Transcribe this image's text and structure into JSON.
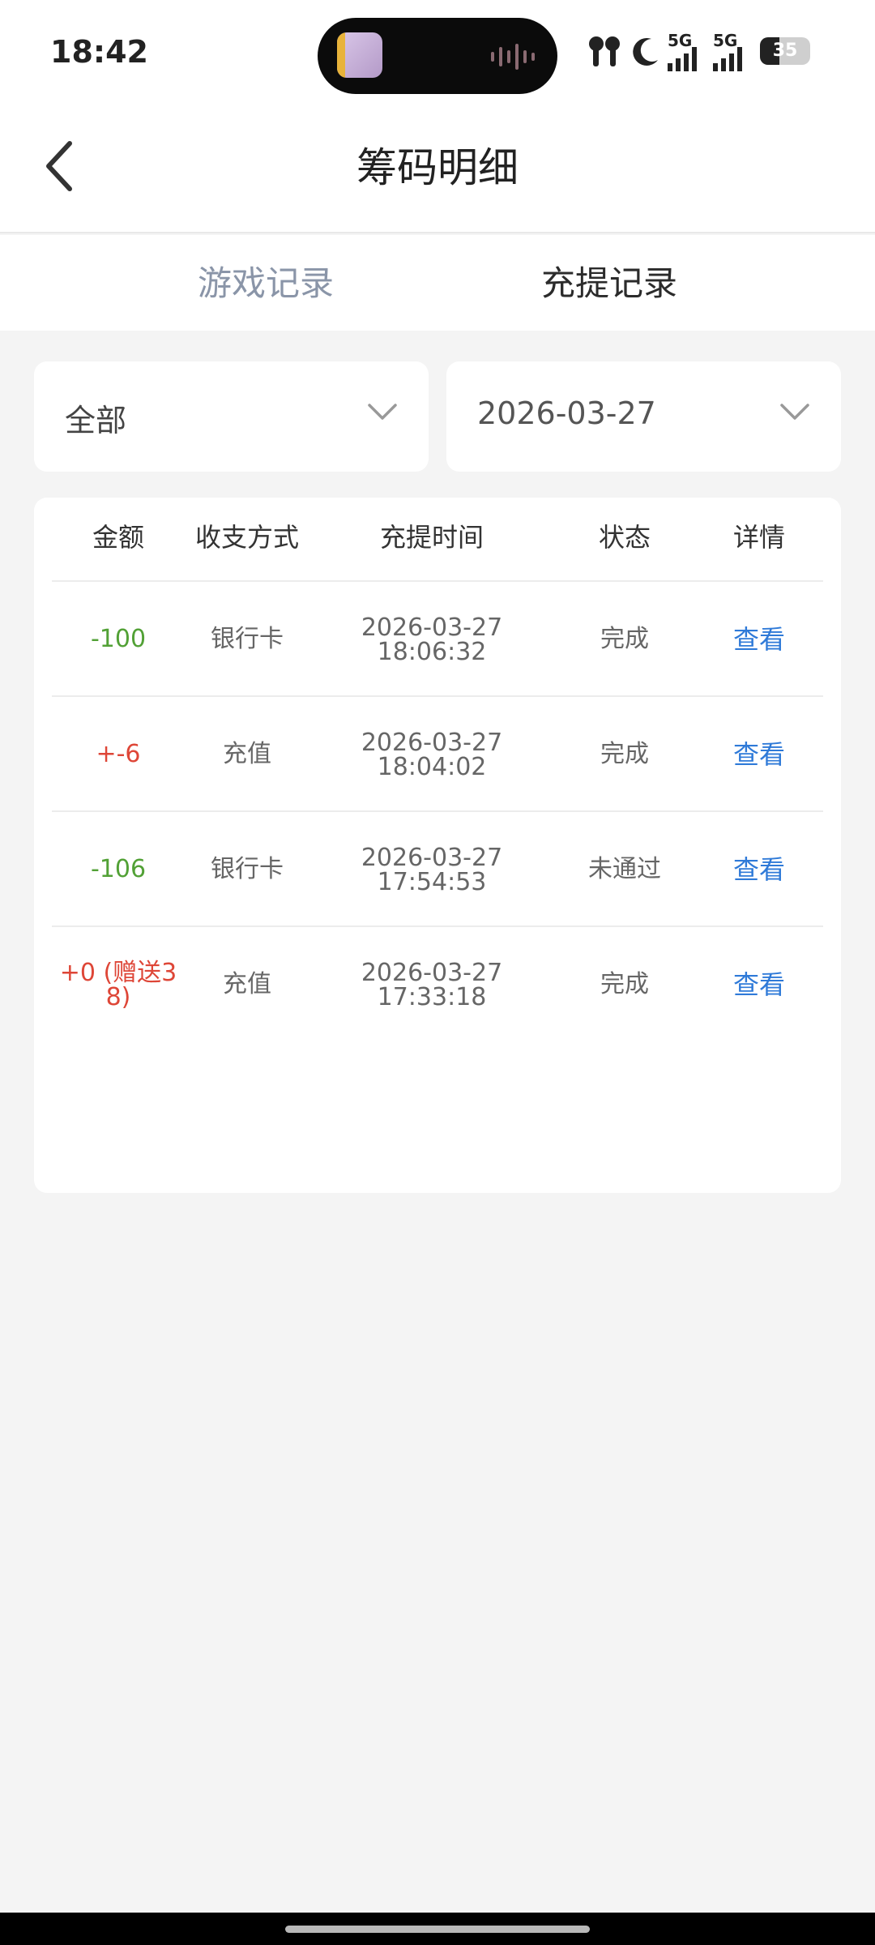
{
  "status_bar": {
    "time": "18:42",
    "network_left": "5G",
    "network_right": "5G",
    "battery": "35"
  },
  "header": {
    "title": "筹码明细",
    "back_icon": "chevron-left-icon"
  },
  "tabs": [
    {
      "label": "游戏记录",
      "active": false
    },
    {
      "label": "充提记录",
      "active": true
    }
  ],
  "filters": {
    "type": "全部",
    "date": "2026-03-27"
  },
  "table": {
    "headers": [
      "金额",
      "收支方式",
      "充提时间",
      "状态",
      "详情"
    ],
    "rows": [
      {
        "amount": "-100",
        "method": "银行卡",
        "date": "2026-03-27",
        "time": "18:06:32",
        "status": "完成",
        "detail": "查看"
      },
      {
        "amount": "+-6",
        "method": "充值",
        "date": "2026-03-27",
        "time": "18:04:02",
        "status": "完成",
        "detail": "查看"
      },
      {
        "amount": "-106",
        "method": "银行卡",
        "date": "2026-03-27",
        "time": "17:54:53",
        "status": "未通过",
        "detail": "查看"
      },
      {
        "amount": "+0 (赠送3",
        "amount_line2": "8)",
        "method": "充值",
        "date": "2026-03-27",
        "time": "17:33:18",
        "status": "完成",
        "detail": "查看"
      }
    ]
  },
  "colors": {
    "negative": "#52a136",
    "positive": "#de4637",
    "link": "#2f7ad8",
    "background": "#f4f4f4"
  }
}
